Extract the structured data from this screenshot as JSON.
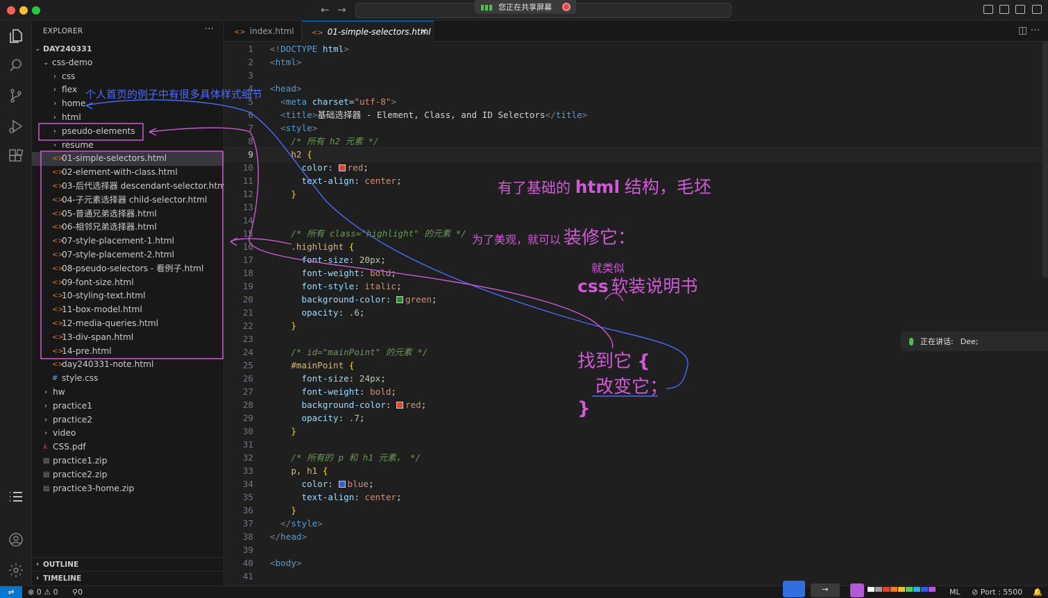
{
  "titlebar": {
    "share_label": "您正在共享屏幕",
    "nav_back": "←",
    "nav_forward": "→"
  },
  "sidebar": {
    "title": "EXPLORER",
    "more": "···",
    "root": "DAY240331",
    "folder_css_demo": "css-demo",
    "tree": [
      {
        "label": "css",
        "kind": "folder",
        "depth": 2
      },
      {
        "label": "flex",
        "kind": "folder",
        "depth": 2
      },
      {
        "label": "home",
        "kind": "folder",
        "depth": 2
      },
      {
        "label": "html",
        "kind": "folder",
        "depth": 2
      },
      {
        "label": "pseudo-elements",
        "kind": "folder",
        "depth": 2
      },
      {
        "label": "resume",
        "kind": "folder",
        "depth": 2
      },
      {
        "label": "01-simple-selectors.html",
        "kind": "html",
        "depth": 2,
        "selected": true
      },
      {
        "label": "02-element-with-class.html",
        "kind": "html",
        "depth": 2
      },
      {
        "label": "03-后代选择器 descendant-selector.html",
        "kind": "html",
        "depth": 2
      },
      {
        "label": "04-子元素选择器 child-selector.html",
        "kind": "html",
        "depth": 2
      },
      {
        "label": "05-普通兄弟选择器.html",
        "kind": "html",
        "depth": 2
      },
      {
        "label": "06-相邻兄弟选择器.html",
        "kind": "html",
        "depth": 2
      },
      {
        "label": "07-style-placement-1.html",
        "kind": "html",
        "depth": 2
      },
      {
        "label": "07-style-placement-2.html",
        "kind": "html",
        "depth": 2
      },
      {
        "label": "08-pseudo-selectors - 看例子.html",
        "kind": "html",
        "depth": 2
      },
      {
        "label": "09-font-size.html",
        "kind": "html",
        "depth": 2
      },
      {
        "label": "10-styling-text.html",
        "kind": "html",
        "depth": 2
      },
      {
        "label": "11-box-model.html",
        "kind": "html",
        "depth": 2
      },
      {
        "label": "12-media-queries.html",
        "kind": "html",
        "depth": 2
      },
      {
        "label": "13-div-span.html",
        "kind": "html",
        "depth": 2
      },
      {
        "label": "14-pre.html",
        "kind": "html",
        "depth": 2
      },
      {
        "label": "day240331-note.html",
        "kind": "html",
        "depth": 2
      },
      {
        "label": "style.css",
        "kind": "css",
        "depth": 2
      },
      {
        "label": "hw",
        "kind": "folder",
        "depth": 1
      },
      {
        "label": "practice1",
        "kind": "folder",
        "depth": 1
      },
      {
        "label": "practice2",
        "kind": "folder",
        "depth": 1
      },
      {
        "label": "video",
        "kind": "folder",
        "depth": 1
      },
      {
        "label": "CSS.pdf",
        "kind": "pdf",
        "depth": 1
      },
      {
        "label": "practice1.zip",
        "kind": "zip",
        "depth": 1
      },
      {
        "label": "practice2.zip",
        "kind": "zip",
        "depth": 1
      },
      {
        "label": "practice3-home.zip",
        "kind": "zip",
        "depth": 1
      }
    ],
    "outline": "OUTLINE",
    "timeline": "TIMELINE"
  },
  "tabs": [
    {
      "label": "index.html",
      "active": false
    },
    {
      "label": "01-simple-selectors.html",
      "active": true
    }
  ],
  "tab_close": "×",
  "editor": {
    "current_line": 9,
    "lines": [
      [
        [
          "t-br",
          "<!"
        ],
        [
          "t-tag",
          "DOCTYPE"
        ],
        [
          "t-attr",
          " html"
        ],
        [
          "t-br",
          ">"
        ]
      ],
      [
        [
          "t-br",
          "<"
        ],
        [
          "t-tag",
          "html"
        ],
        [
          "t-br",
          ">"
        ]
      ],
      [],
      [
        [
          "t-br",
          "<"
        ],
        [
          "t-tag",
          "head"
        ],
        [
          "t-br",
          ">"
        ]
      ],
      [
        [
          "t-text",
          "  "
        ],
        [
          "t-br",
          "<"
        ],
        [
          "t-tag",
          "meta"
        ],
        [
          "t-attr",
          " charset"
        ],
        [
          "t-punc",
          "="
        ],
        [
          "t-str",
          "\"utf-8\""
        ],
        [
          "t-br",
          ">"
        ]
      ],
      [
        [
          "t-text",
          "  "
        ],
        [
          "t-br",
          "<"
        ],
        [
          "t-tag",
          "title"
        ],
        [
          "t-br",
          ">"
        ],
        [
          "t-text",
          "基础选择器 - Element, Class, and ID Selectors"
        ],
        [
          "t-br",
          "</"
        ],
        [
          "t-tag",
          "title"
        ],
        [
          "t-br",
          ">"
        ]
      ],
      [
        [
          "t-text",
          "  "
        ],
        [
          "t-br",
          "<"
        ],
        [
          "t-tag",
          "style"
        ],
        [
          "t-br",
          ">"
        ]
      ],
      [
        [
          "t-com",
          "    /* 所有 h2 元素 */"
        ]
      ],
      [
        [
          "t-text",
          "    "
        ],
        [
          "t-sel",
          "h2"
        ],
        [
          "t-text",
          " "
        ],
        [
          "t-brace",
          "{"
        ]
      ],
      [
        [
          "t-text",
          "      "
        ],
        [
          "t-prop",
          "color"
        ],
        [
          "t-punc",
          ": "
        ],
        [
          "swatch",
          "#e0452f"
        ],
        [
          "t-val",
          "red"
        ],
        [
          "t-punc",
          ";"
        ]
      ],
      [
        [
          "t-text",
          "      "
        ],
        [
          "t-prop",
          "text-align"
        ],
        [
          "t-punc",
          ": "
        ],
        [
          "t-val",
          "center"
        ],
        [
          "t-punc",
          ";"
        ]
      ],
      [
        [
          "t-text",
          "    "
        ],
        [
          "t-brace",
          "}"
        ]
      ],
      [],
      [],
      [
        [
          "t-com",
          "    /* 所有 class=\"highlight\" 的元素 */"
        ]
      ],
      [
        [
          "t-text",
          "    "
        ],
        [
          "t-sel",
          ".highlight"
        ],
        [
          "t-text",
          " "
        ],
        [
          "t-brace",
          "{"
        ]
      ],
      [
        [
          "t-text",
          "      "
        ],
        [
          "t-prop",
          "font-size"
        ],
        [
          "t-punc",
          ": "
        ],
        [
          "t-num",
          "20px"
        ],
        [
          "t-punc",
          ";"
        ]
      ],
      [
        [
          "t-text",
          "      "
        ],
        [
          "t-prop",
          "font-weight"
        ],
        [
          "t-punc",
          ": "
        ],
        [
          "t-val",
          "bold"
        ],
        [
          "t-punc",
          ";"
        ]
      ],
      [
        [
          "t-text",
          "      "
        ],
        [
          "t-prop",
          "font-style"
        ],
        [
          "t-punc",
          ": "
        ],
        [
          "t-val",
          "italic"
        ],
        [
          "t-punc",
          ";"
        ]
      ],
      [
        [
          "t-text",
          "      "
        ],
        [
          "t-prop",
          "background-color"
        ],
        [
          "t-punc",
          ": "
        ],
        [
          "swatch",
          "#2e8b2e"
        ],
        [
          "t-val",
          "green"
        ],
        [
          "t-punc",
          ";"
        ]
      ],
      [
        [
          "t-text",
          "      "
        ],
        [
          "t-prop",
          "opacity"
        ],
        [
          "t-punc",
          ": "
        ],
        [
          "t-num",
          ".6"
        ],
        [
          "t-punc",
          ";"
        ]
      ],
      [
        [
          "t-text",
          "    "
        ],
        [
          "t-brace",
          "}"
        ]
      ],
      [],
      [
        [
          "t-com",
          "    /* id=\"mainPoint\" 的元素 */"
        ]
      ],
      [
        [
          "t-text",
          "    "
        ],
        [
          "t-sel",
          "#mainPoint"
        ],
        [
          "t-text",
          " "
        ],
        [
          "t-brace",
          "{"
        ]
      ],
      [
        [
          "t-text",
          "      "
        ],
        [
          "t-prop",
          "font-size"
        ],
        [
          "t-punc",
          ": "
        ],
        [
          "t-num",
          "24px"
        ],
        [
          "t-punc",
          ";"
        ]
      ],
      [
        [
          "t-text",
          "      "
        ],
        [
          "t-prop",
          "font-weight"
        ],
        [
          "t-punc",
          ": "
        ],
        [
          "t-val",
          "bold"
        ],
        [
          "t-punc",
          ";"
        ]
      ],
      [
        [
          "t-text",
          "      "
        ],
        [
          "t-prop",
          "background-color"
        ],
        [
          "t-punc",
          ": "
        ],
        [
          "swatch",
          "#e0452f"
        ],
        [
          "t-val",
          "red"
        ],
        [
          "t-punc",
          ";"
        ]
      ],
      [
        [
          "t-text",
          "      "
        ],
        [
          "t-prop",
          "opacity"
        ],
        [
          "t-punc",
          ": "
        ],
        [
          "t-num",
          ".7"
        ],
        [
          "t-punc",
          ";"
        ]
      ],
      [
        [
          "t-text",
          "    "
        ],
        [
          "t-brace",
          "}"
        ]
      ],
      [],
      [
        [
          "t-com",
          "    /* 所有的 p 和 h1 元素， */"
        ]
      ],
      [
        [
          "t-text",
          "    "
        ],
        [
          "t-sel",
          "p, h1"
        ],
        [
          "t-text",
          " "
        ],
        [
          "t-brace",
          "{"
        ]
      ],
      [
        [
          "t-text",
          "      "
        ],
        [
          "t-prop",
          "color"
        ],
        [
          "t-punc",
          ": "
        ],
        [
          "swatch",
          "#2f5fe0"
        ],
        [
          "t-val",
          "blue"
        ],
        [
          "t-punc",
          ";"
        ]
      ],
      [
        [
          "t-text",
          "      "
        ],
        [
          "t-prop",
          "text-align"
        ],
        [
          "t-punc",
          ": "
        ],
        [
          "t-val",
          "center"
        ],
        [
          "t-punc",
          ";"
        ]
      ],
      [
        [
          "t-text",
          "    "
        ],
        [
          "t-brace",
          "}"
        ]
      ],
      [
        [
          "t-text",
          "  "
        ],
        [
          "t-br",
          "</"
        ],
        [
          "t-tag",
          "style"
        ],
        [
          "t-br",
          ">"
        ]
      ],
      [
        [
          "t-br",
          "</"
        ],
        [
          "t-tag",
          "head"
        ],
        [
          "t-br",
          ">"
        ]
      ],
      [],
      [
        [
          "t-br",
          "<"
        ],
        [
          "t-tag",
          "body"
        ],
        [
          "t-br",
          ">"
        ]
      ],
      []
    ]
  },
  "annotations": {
    "home_note": "个人首页的例子中有很多具体样式细节",
    "html_structure_a": "有了基础的",
    "html_structure_b": "html",
    "html_structure_c": "结构，毛坯",
    "decorate_small": "为了美观，就可以",
    "decorate_big": "装修它：",
    "like_a": "就类似",
    "css_word": "css",
    "manual": "软装说明书",
    "find_it": "找到它",
    "find_brace": "{",
    "change_it": "改变它；",
    "close_brace": "}"
  },
  "speaking": {
    "label": "正在讲话:",
    "name": "Dee;"
  },
  "statusbar": {
    "remote_icon": "⇌",
    "errors": "0",
    "warnings": "0",
    "ports_count": "0",
    "ml": "ML",
    "port": "Port : 5500",
    "bell": "🔔"
  },
  "colors": {
    "accent": "#0078d4",
    "annotation_blue": "#4d6bff",
    "annotation_pink": "#d05ad6"
  }
}
